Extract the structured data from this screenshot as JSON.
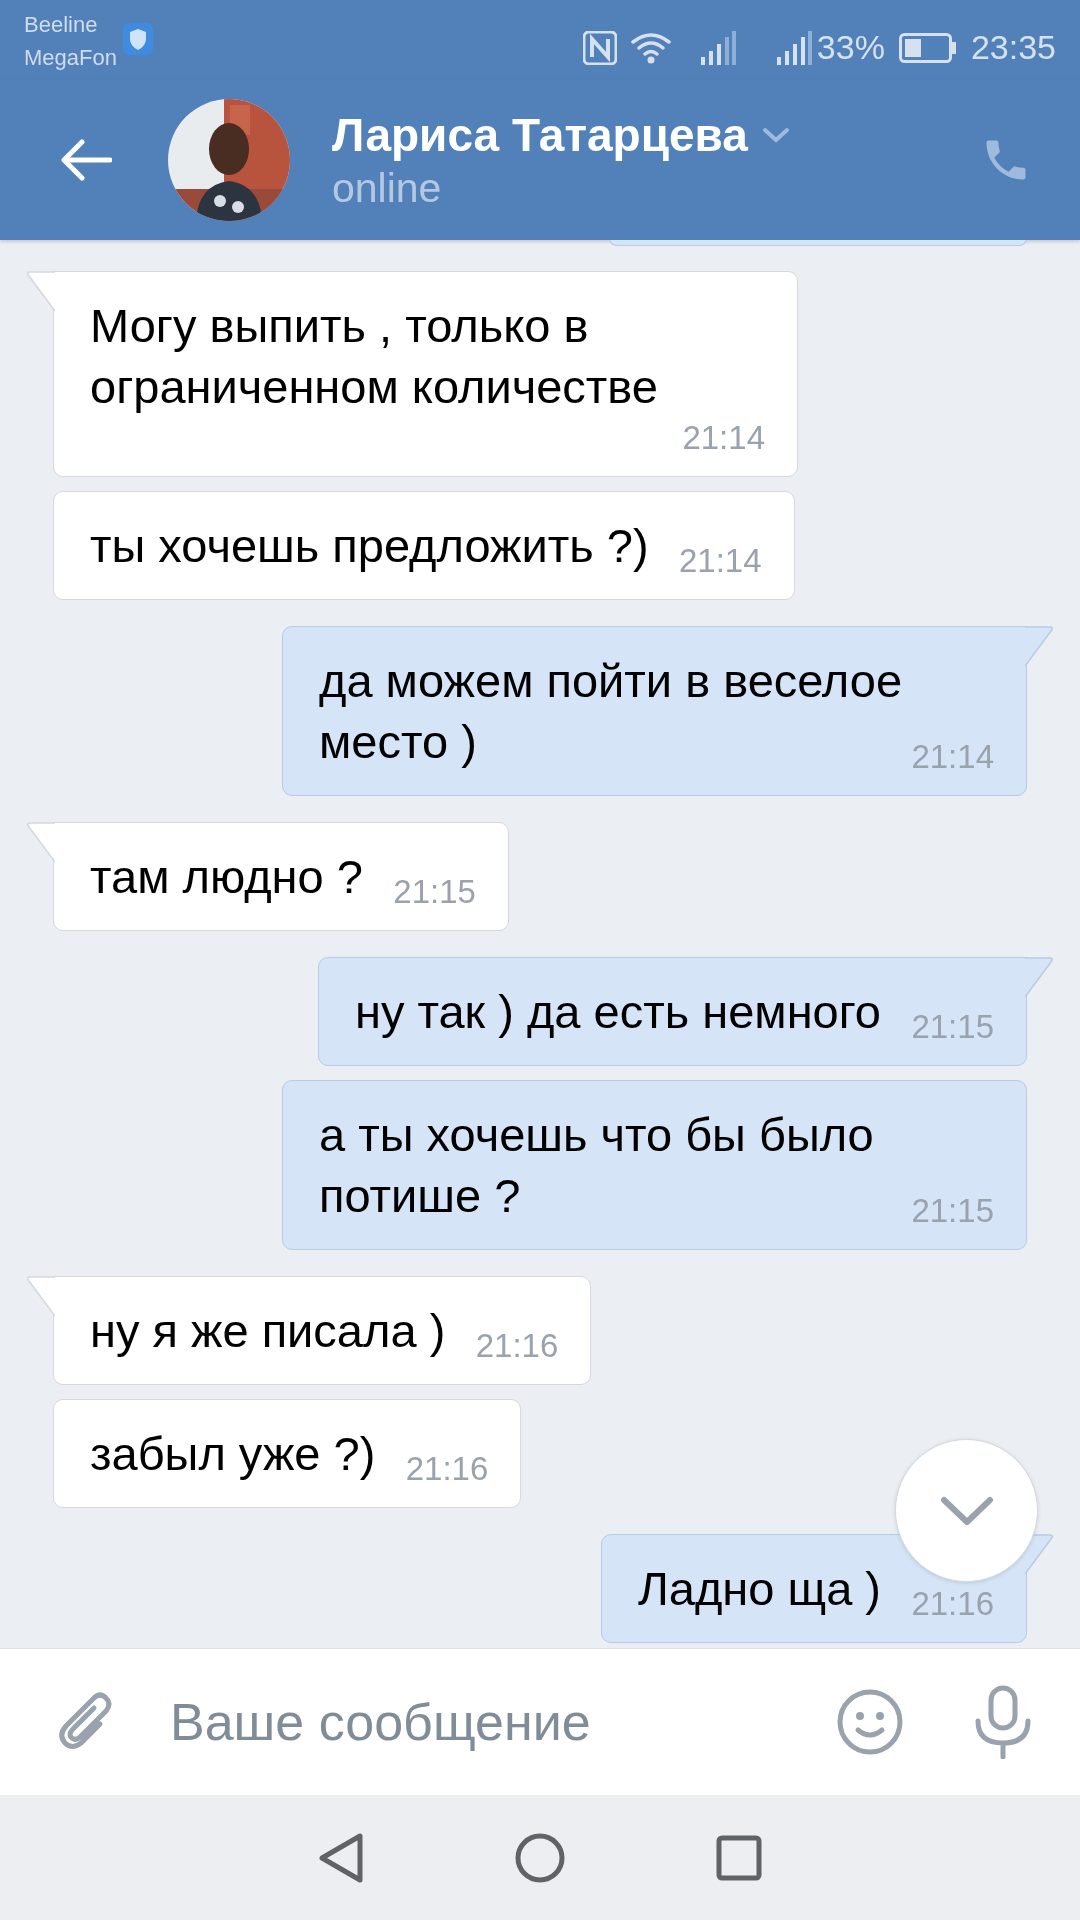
{
  "status_bar": {
    "carriers": [
      "Beeline",
      "MegaFon"
    ],
    "battery": "33%",
    "time": "23:35"
  },
  "header": {
    "name": "Лариса Татарцева",
    "status": "online"
  },
  "messages": [
    {
      "text": "Могу выпить , только в ограниченном количестве",
      "time": "21:14",
      "outgoing": false
    },
    {
      "text": "ты хочешь предложить ?)",
      "time": "21:14",
      "outgoing": false
    },
    {
      "text": "да можем пойти в веселое место )",
      "time": "21:14",
      "outgoing": true
    },
    {
      "text": "там людно ?",
      "time": "21:15",
      "outgoing": false
    },
    {
      "text": "ну так ) да есть немного",
      "time": "21:15",
      "outgoing": true
    },
    {
      "text": "а ты хочешь что бы было потише ?",
      "time": "21:15",
      "outgoing": true
    },
    {
      "text": "ну я же писала )",
      "time": "21:16",
      "outgoing": false
    },
    {
      "text": "забыл уже ?)",
      "time": "21:16",
      "outgoing": false
    },
    {
      "text": "Ладно ща )",
      "time": "21:16",
      "outgoing": true
    }
  ],
  "input": {
    "placeholder": "Ваше сообщение"
  }
}
